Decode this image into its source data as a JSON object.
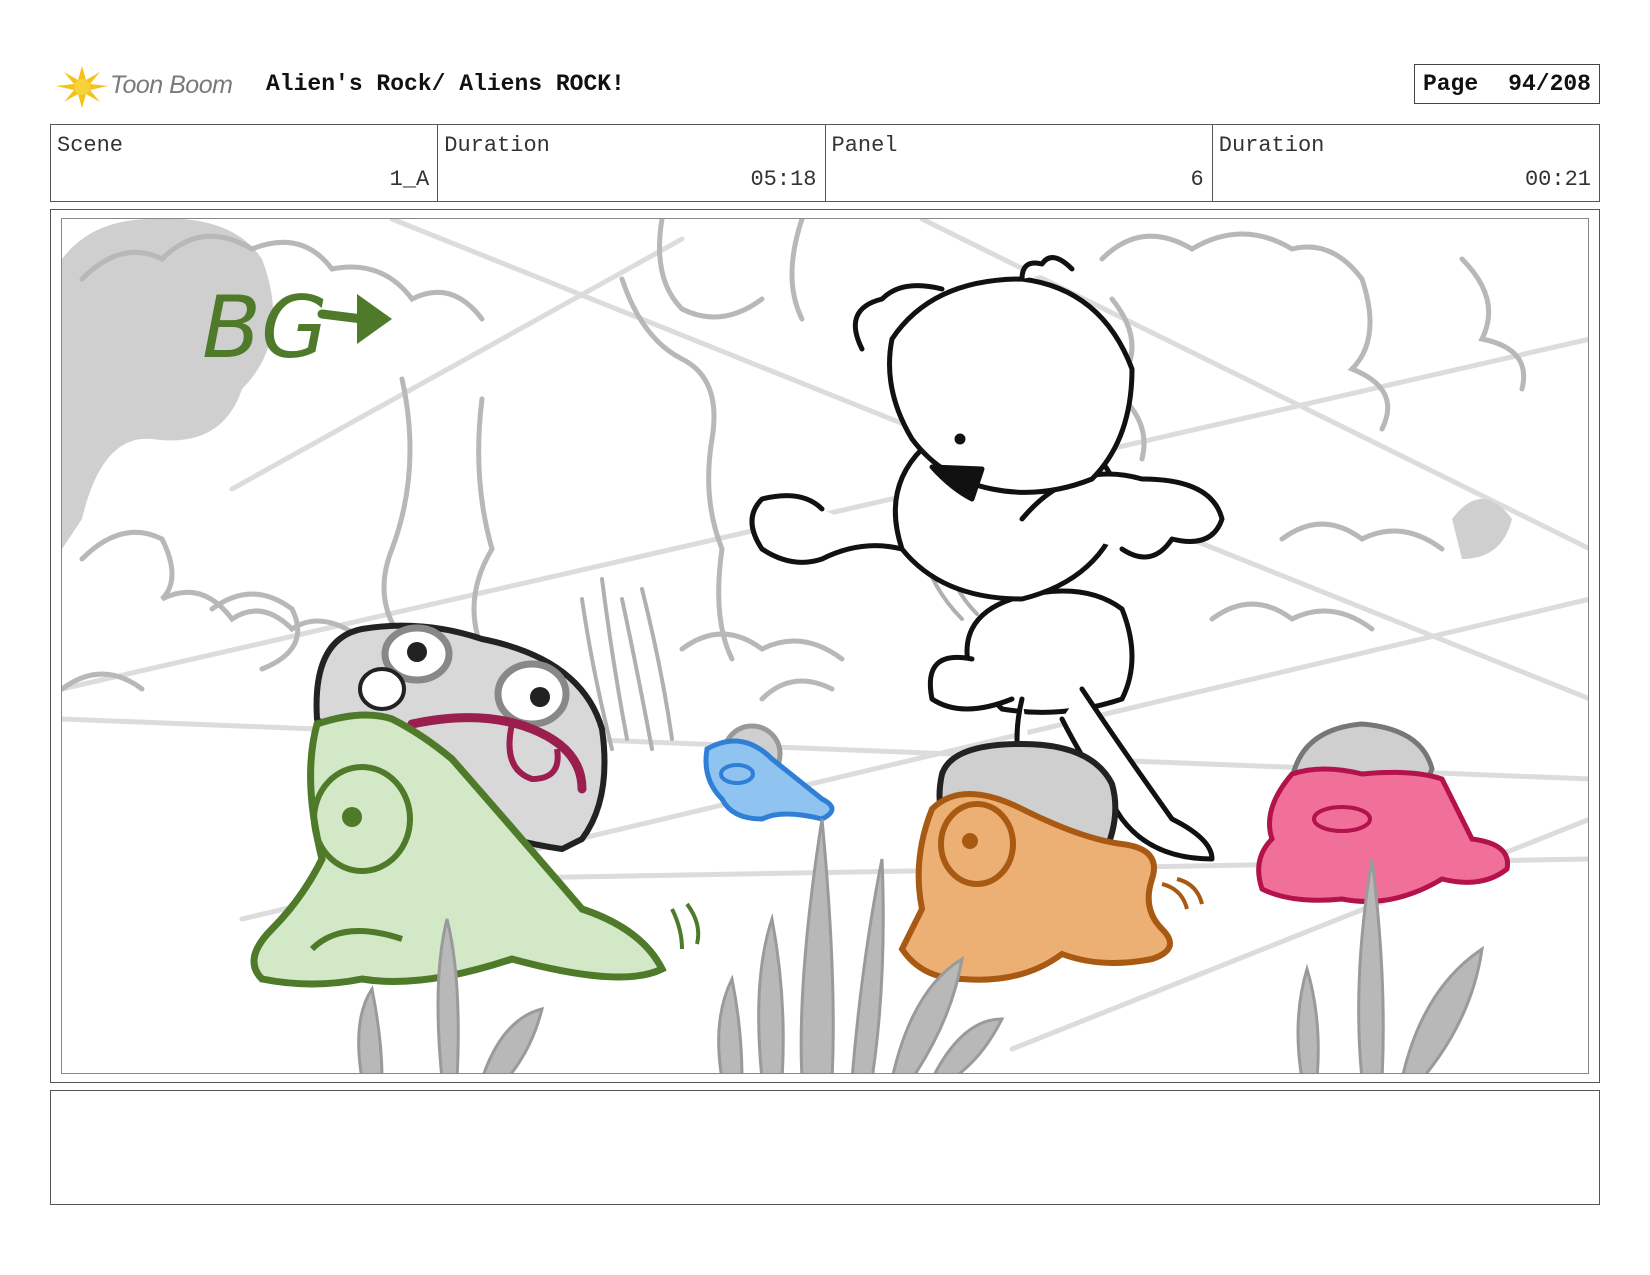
{
  "header": {
    "logo_text": "Toon Boom",
    "title": "Alien's Rock/ Aliens ROCK!",
    "page_label": "Page",
    "page_value": "94/208"
  },
  "info": {
    "scene_label": "Scene",
    "scene_value": "1_A",
    "duration_label": "Duration",
    "duration_value": "05:18",
    "panel_label": "Panel",
    "panel_value": "6",
    "panel_duration_label": "Duration",
    "panel_duration_value": "00:21"
  },
  "panel_image": {
    "annotation": "BG",
    "colors": {
      "annotation": "#4f7a2a",
      "green_alien": "#d3e8c6",
      "blue_alien": "#8fc3f0",
      "orange_alien": "#ecb074",
      "pink_alien": "#f0709a",
      "rock": "#cfcfcf"
    }
  },
  "notes": {}
}
